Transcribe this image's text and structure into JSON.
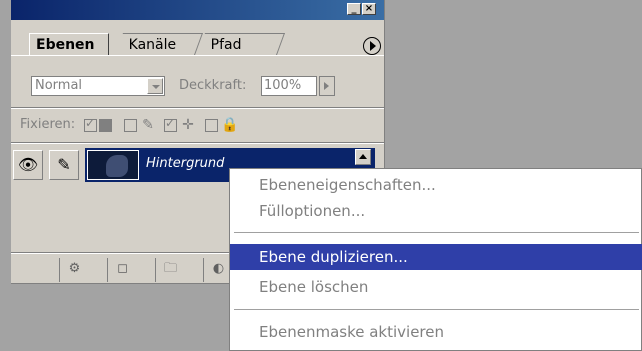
{
  "window": {
    "minimize_label": "_",
    "close_label": "×"
  },
  "tabs": [
    {
      "label": "Ebenen"
    },
    {
      "label": "Kanäle"
    },
    {
      "label": "Pfad"
    }
  ],
  "blend_mode": {
    "value": "Normal"
  },
  "opacity": {
    "label": "Deckkraft:",
    "value": "100%"
  },
  "lock": {
    "label": "Fixieren:"
  },
  "layer": {
    "name": "Hintergrund"
  },
  "context_menu": {
    "items": [
      {
        "label": "Ebeneneigenschaften..."
      },
      {
        "label": "Fülloptionen..."
      },
      {
        "label": "Ebene duplizieren..."
      },
      {
        "label": "Ebene löschen"
      },
      {
        "label": "Ebenenmaske aktivieren"
      }
    ]
  }
}
